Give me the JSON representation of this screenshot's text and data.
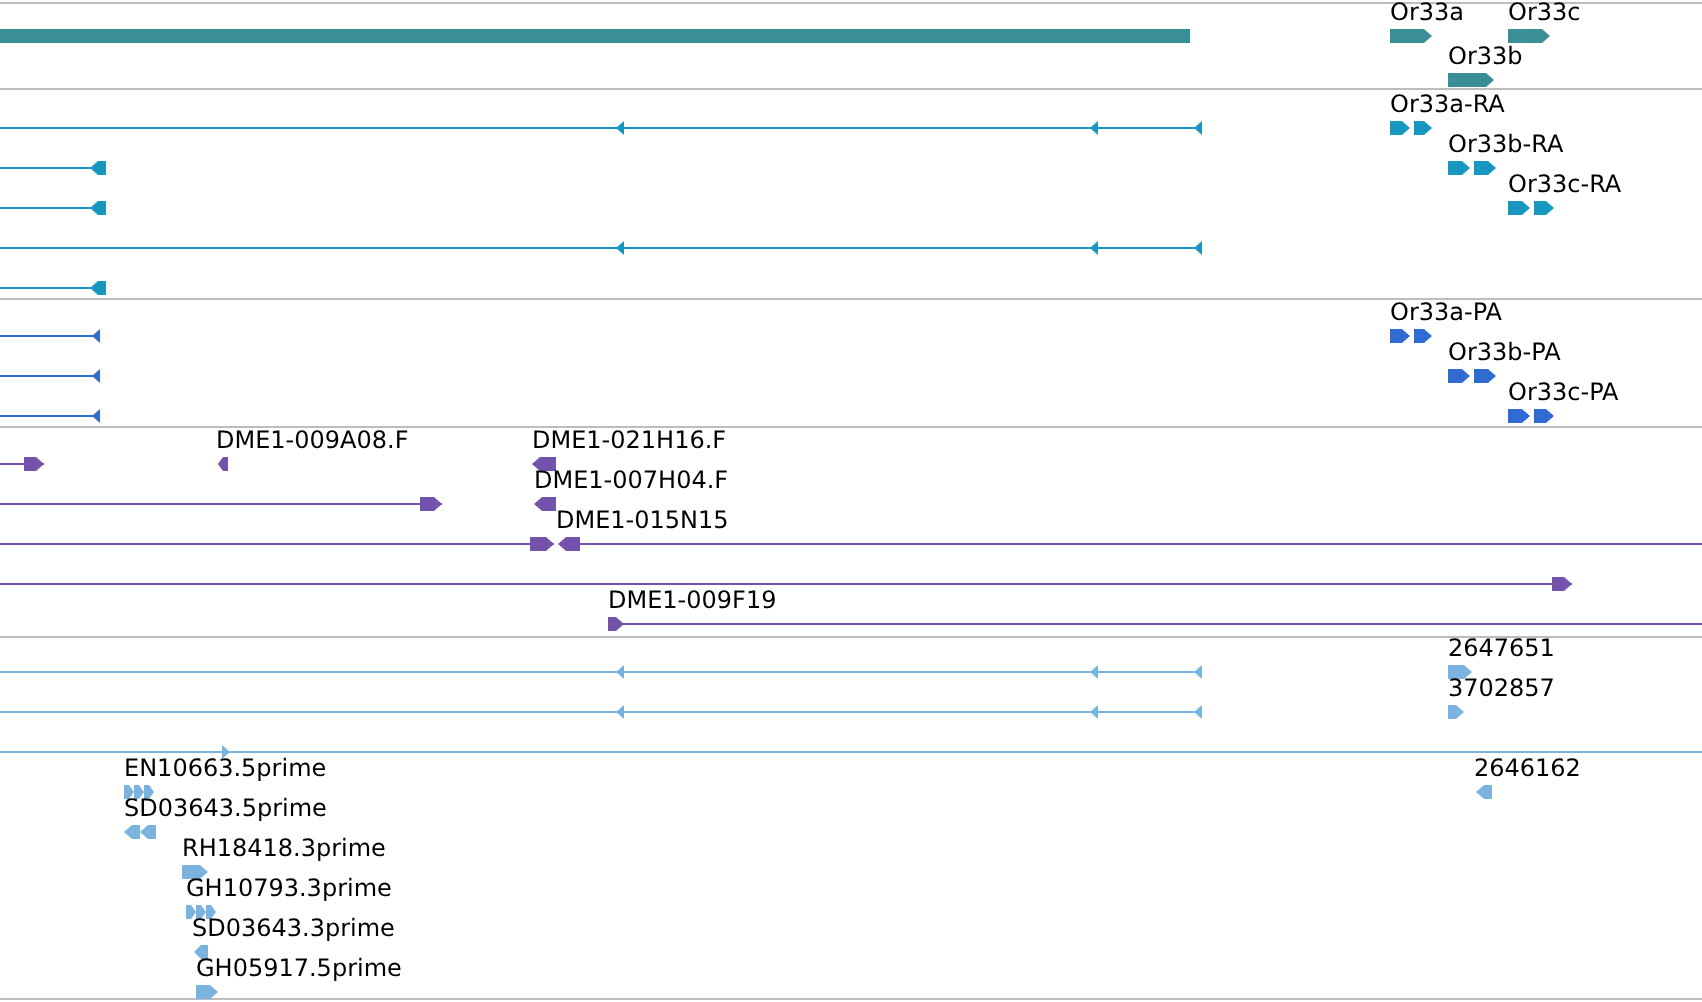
{
  "tracks": [
    {
      "color": "#3a8f96",
      "features": [
        {
          "reverse": true
        },
        {
          "label": "Or33a",
          "reverse": false
        },
        {
          "label": "Or33c",
          "reverse": false
        },
        {
          "label": "Or33b",
          "reverse": false
        }
      ]
    },
    {
      "color": "#1797c0",
      "features": [
        {
          "reverse": true
        },
        {
          "label": "Or33a-RA",
          "reverse": false
        },
        {
          "reverse": true
        },
        {
          "label": "Or33b-RA",
          "reverse": false
        },
        {
          "reverse": true
        },
        {
          "label": "Or33c-RA",
          "reverse": false
        },
        {
          "reverse": true
        },
        {
          "reverse": true
        }
      ]
    },
    {
      "color": "#2f6bd0",
      "features": [
        {
          "reverse": true
        },
        {
          "label": "Or33a-PA",
          "reverse": false
        },
        {
          "reverse": true
        },
        {
          "label": "Or33b-PA",
          "reverse": false
        },
        {
          "reverse": true
        },
        {
          "label": "Or33c-PA",
          "reverse": false
        }
      ]
    },
    {
      "color": "#7352aa",
      "features": [
        {
          "reverse": false
        },
        {
          "label": "DME1-009A08.F",
          "reverse": true
        },
        {
          "label": "DME1-021H16.F",
          "reverse": true
        },
        {
          "reverse": false
        },
        {
          "label": "DME1-007H04.F",
          "reverse": true
        },
        {
          "reverse": false
        },
        {
          "label": "DME1-015N15",
          "reverse": true
        },
        {
          "reverse": false
        },
        {
          "label": "DME1-009F19",
          "reverse": false
        }
      ]
    },
    {
      "color": "#7ab4de",
      "features": [
        {
          "reverse": true
        },
        {
          "label": "2647651",
          "reverse": false
        },
        {
          "reverse": true
        },
        {
          "label": "3702857",
          "reverse": false
        },
        {
          "reverse": false
        },
        {
          "label": "EN10663.5prime",
          "reverse": false
        },
        {
          "label": "2646162",
          "reverse": true
        },
        {
          "label": "SD03643.5prime",
          "reverse": true
        },
        {
          "label": "RH18418.3prime",
          "reverse": false
        },
        {
          "label": "GH10793.3prime",
          "reverse": false
        },
        {
          "label": "SD03643.3prime",
          "reverse": true
        },
        {
          "label": "GH05917.5prime",
          "reverse": false
        }
      ]
    }
  ]
}
